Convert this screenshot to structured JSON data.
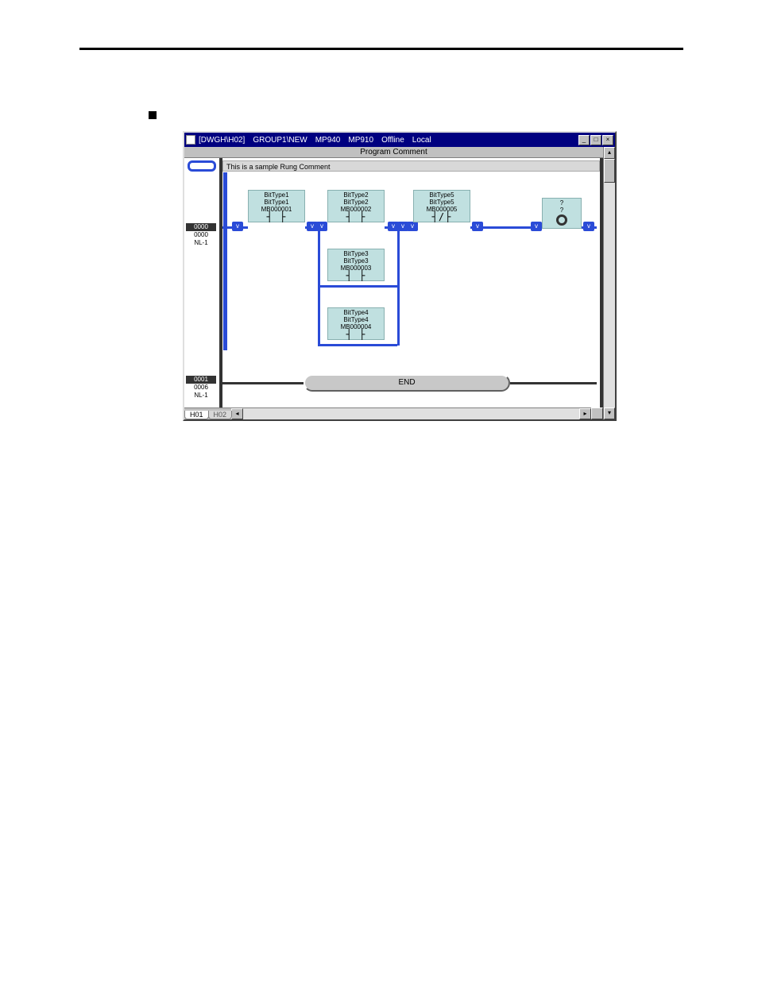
{
  "titlebar": {
    "doc": "[DWGH\\H02]",
    "group": "GROUP1\\NEW",
    "model1": "MP940",
    "model2": "MP910",
    "mode": "Offline",
    "scope": "Local"
  },
  "window_buttons": {
    "min": "_",
    "max": "□",
    "close": "×"
  },
  "program_comment_label": "Program Comment",
  "rung_comment": "This is a sample Rung Comment",
  "rung0": {
    "badge": "0000",
    "addr": "0000",
    "nl": "NL-1"
  },
  "rung1": {
    "badge": "0001",
    "addr": "0006",
    "nl": "NL-1"
  },
  "elements": {
    "c1": {
      "name1": "BitType1",
      "name2": "BitType1",
      "addr": "MB000001",
      "sym": "┤ ├"
    },
    "c2": {
      "name1": "BitType2",
      "name2": "BitType2",
      "addr": "MB000002",
      "sym": "┤ ├"
    },
    "c3": {
      "name1": "BitType3",
      "name2": "BitType3",
      "addr": "MB000003",
      "sym": "┤ ├"
    },
    "c4": {
      "name1": "BitType4",
      "name2": "BitType4",
      "addr": "MB000004",
      "sym": "┤ ├"
    },
    "c5": {
      "name1": "BitType5",
      "name2": "BitType5",
      "addr": "MB000005",
      "sym": "┤/├"
    },
    "coil": {
      "q1": "?",
      "q2": "?"
    }
  },
  "node_tag": "v",
  "end_label": "END",
  "tabs": {
    "t1": "H01",
    "t2": "H02"
  },
  "scroll": {
    "up": "▴",
    "down": "▾",
    "left": "◂",
    "right": "▸"
  }
}
